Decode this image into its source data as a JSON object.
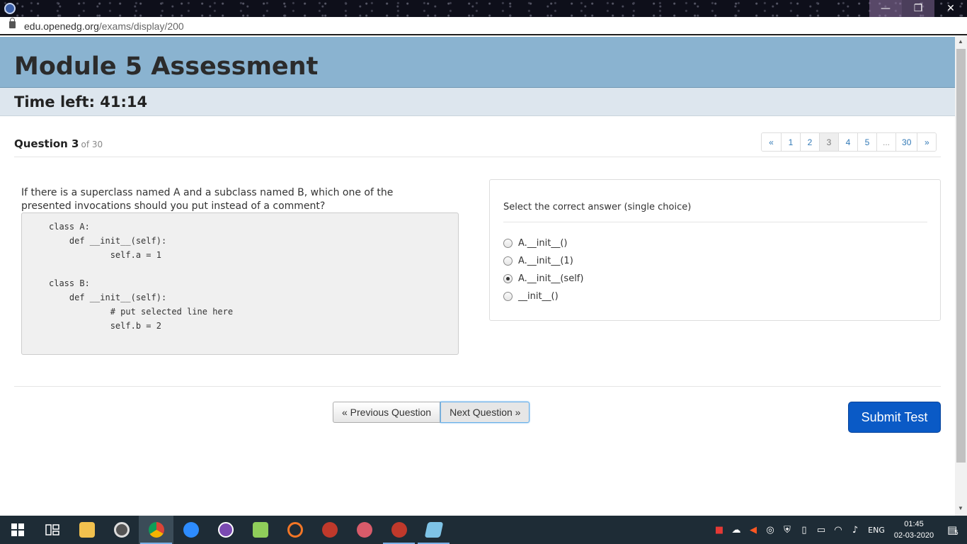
{
  "browser": {
    "url_host": "edu.openedg.org",
    "url_path": "/exams/display/200",
    "window_buttons": [
      "—",
      "❐",
      "✕"
    ]
  },
  "page": {
    "title": "Module 5 Assessment",
    "time_left": "Time left: 41:14"
  },
  "question": {
    "label": "Question 3",
    "of_total": "of 30",
    "text": "If there is a superclass named A and a subclass named B, which one of the presented invocations should you put instead of a comment?",
    "code_lines": [
      "class A:",
      "    def __init__(self):",
      "            self.a = 1",
      "",
      "class B:",
      "    def __init__(self):",
      "            # put selected line here",
      "            self.b = 2"
    ]
  },
  "pagination": [
    "«",
    "1",
    "2",
    "3",
    "4",
    "5",
    "...",
    "30",
    "»"
  ],
  "pagination_current": "3",
  "answers": {
    "instruction": "Select the correct answer (single choice)",
    "options": [
      "A.__init__()",
      "A.__init__(1)",
      "A.__init__(self)",
      "__init__()"
    ],
    "selected": "A.__init__(self)"
  },
  "nav": {
    "prev_label": "« Previous Question",
    "next_label": "Next Question »",
    "submit_label": "Submit Test"
  },
  "taskbar": {
    "apps": [
      "start-icon",
      "task-view-icon",
      "file-explorer-icon",
      "media-player-icon",
      "chrome-icon",
      "zoom-icon",
      "app-purple-icon",
      "notepad-plus-icon",
      "jupyter-icon",
      "spider-icon",
      "paint-icon",
      "spider-icon-2",
      "notes-icon"
    ],
    "language": "ENG",
    "time": "01:45",
    "date": "02-03-2020",
    "notifications": "5",
    "colors": {
      "background": "#1e2c36",
      "accent": "#7ab0e6"
    }
  }
}
